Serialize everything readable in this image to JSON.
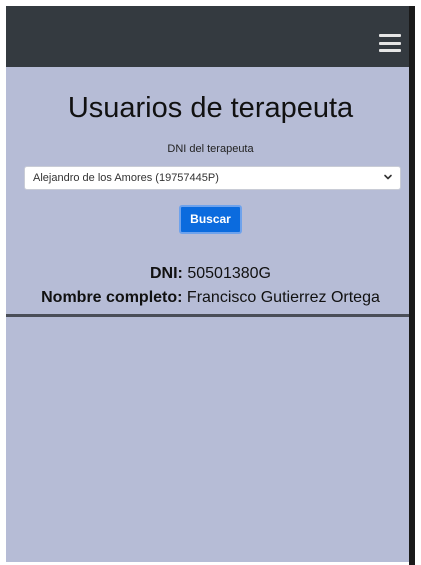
{
  "header": {
    "menu_icon": "hamburger-menu-icon"
  },
  "main": {
    "title": "Usuarios de terapeuta",
    "dni_label": "DNI del terapeuta",
    "select": {
      "selected_value": "Alejandro de los Amores (19757445P)",
      "chevron_icon": "chevron-down-icon"
    },
    "search_button": "Buscar"
  },
  "result": {
    "dni_label": "DNI:",
    "dni_value": "50501380G",
    "name_label": "Nombre completo:",
    "name_value": "Francisco Gutierrez Ortega"
  },
  "colors": {
    "navbar": "#343a40",
    "background": "#b6bcd6",
    "button": "#0b6bde"
  }
}
